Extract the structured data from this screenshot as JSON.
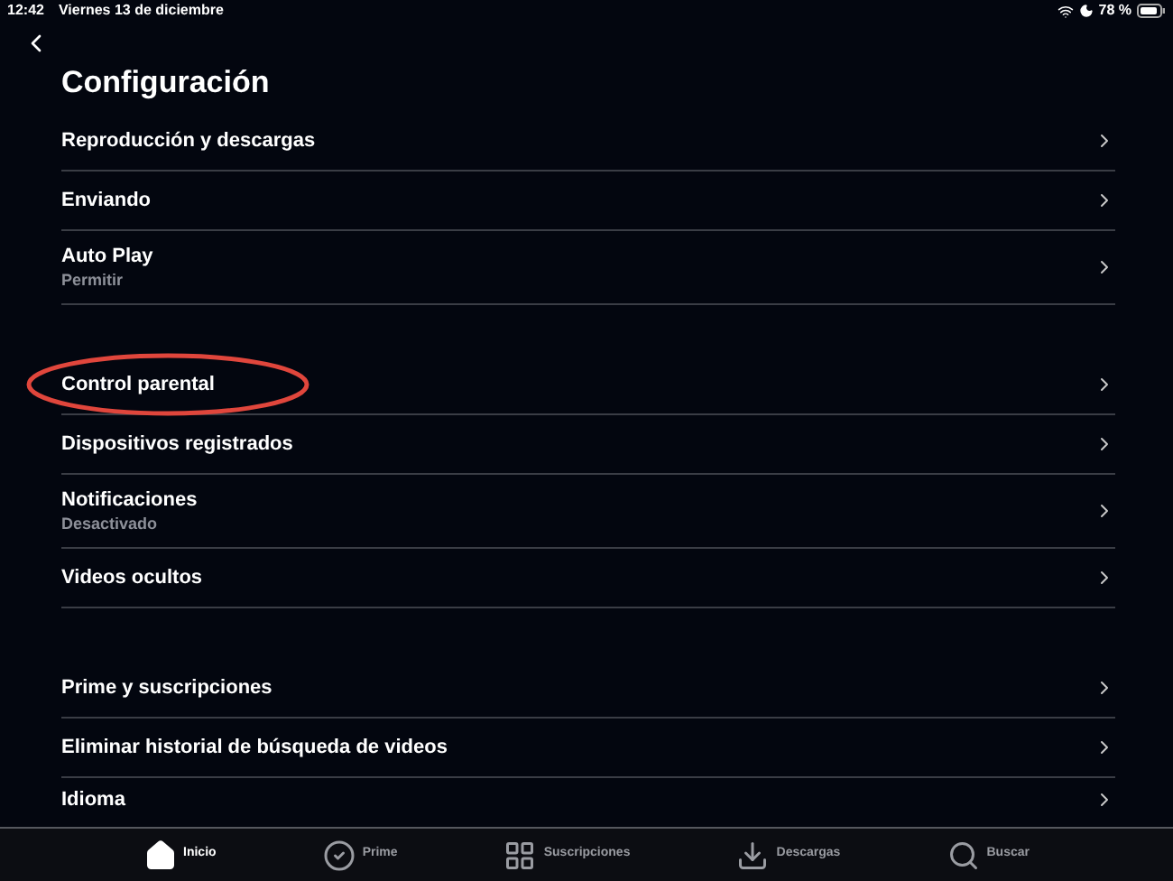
{
  "status_bar": {
    "time": "12:42",
    "date": "Viernes 13 de diciembre",
    "battery": "78 %"
  },
  "title": "Configuración",
  "groups": [
    {
      "items": [
        {
          "label": "Reproducción y descargas",
          "circled": false
        },
        {
          "label": "Enviando",
          "circled": false
        },
        {
          "label": "Auto Play",
          "subtitle": "Permitir",
          "circled": false
        }
      ]
    },
    {
      "items": [
        {
          "label": "Control parental",
          "circled": true
        },
        {
          "label": "Dispositivos registrados",
          "circled": false
        },
        {
          "label": "Notificaciones",
          "subtitle": "Desactivado",
          "circled": false
        },
        {
          "label": "Videos ocultos",
          "circled": false
        }
      ]
    },
    {
      "items": [
        {
          "label": "Prime y suscripciones",
          "circled": false
        },
        {
          "label": "Eliminar historial de búsqueda de videos",
          "circled": false
        },
        {
          "label": "Idioma",
          "circled": false
        }
      ]
    }
  ],
  "tabs": [
    {
      "kind": "home",
      "label": "Inicio",
      "selected": true
    },
    {
      "kind": "prime",
      "label": "Prime",
      "selected": false
    },
    {
      "kind": "subscriptions",
      "label": "Suscripciones",
      "selected": false
    },
    {
      "kind": "downloads",
      "label": "Descargas",
      "selected": false
    },
    {
      "kind": "search",
      "label": "Buscar",
      "selected": false
    }
  ]
}
